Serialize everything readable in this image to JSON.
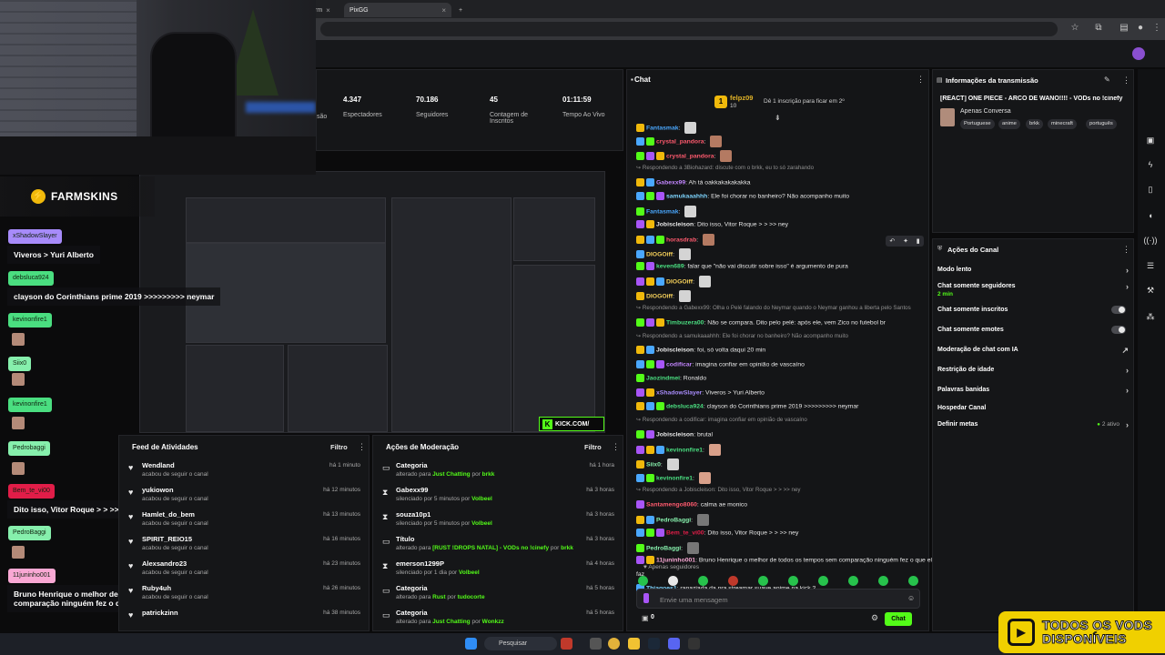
{
  "browser": {
    "tabs": [
      {
        "label": "rm"
      },
      {
        "label": "PixGG"
      }
    ]
  },
  "overlay": {
    "farmskins": "FARMSKINS",
    "chat": [
      {
        "name": "xShadowSlayer",
        "color": "#a78bfa",
        "msg": "Viveros > Yuri Alberto"
      },
      {
        "name": "debsluca924",
        "color": "#4ade80",
        "msg": "clayson do Corinthians prime 2019 >>>>>>>>> neymar"
      },
      {
        "name": "kevinonfire1",
        "color": "#4ade80",
        "msg": ""
      },
      {
        "name": "Siix0",
        "color": "#86efac",
        "msg": ""
      },
      {
        "name": "kevinonfire1",
        "color": "#4ade80",
        "msg": ""
      },
      {
        "name": "Pedrobaggi",
        "color": "#86efac",
        "msg": ""
      },
      {
        "name": "Bem_te_vi00",
        "color": "#e11d48",
        "msg": "Dito isso, Vitor Roque > > >> ney"
      },
      {
        "name": "PedroBaggi",
        "color": "#86efac",
        "msg": ""
      },
      {
        "name": "11juninho001",
        "color": "#f9a8d4",
        "msg": "Bruno Henrique o melhor de todos os tempos sem comparação ninguém fez o que ele faz"
      }
    ]
  },
  "stats": [
    {
      "value": "4.347",
      "label": "Espectadores"
    },
    {
      "value": "70.186",
      "label": "Seguidores"
    },
    {
      "value": "45",
      "label": "Contagem de Inscritos"
    },
    {
      "value": "01:11:59",
      "label": "Tempo Ao Vivo"
    }
  ],
  "stats_partial_label": "são",
  "kick_badge": "KICK.COM/",
  "feed": {
    "title": "Feed de Atividades",
    "filter": "Filtro",
    "items": [
      {
        "name": "Wendland",
        "desc": "acabou de seguir o canal",
        "time": "há 1 minuto"
      },
      {
        "name": "yukiowon",
        "desc": "acabou de seguir o canal",
        "time": "há 12 minutos"
      },
      {
        "name": "Hamlet_do_bem",
        "desc": "acabou de seguir o canal",
        "time": "há 13 minutos"
      },
      {
        "name": "SPIRIT_REIO15",
        "desc": "acabou de seguir o canal",
        "time": "há 16 minutos"
      },
      {
        "name": "Alexsandro23",
        "desc": "acabou de seguir o canal",
        "time": "há 23 minutos"
      },
      {
        "name": "Ruby4uh",
        "desc": "acabou de seguir o canal",
        "time": "há 26 minutos"
      },
      {
        "name": "patrickzinn",
        "desc": "",
        "time": "há 38 minutos"
      }
    ]
  },
  "moderation": {
    "title": "Ações de Moderação",
    "filter": "Filtro",
    "items": [
      {
        "icon": "tv-icon",
        "glyph": "▭",
        "name": "Categoria",
        "pre": "alterado para ",
        "hl": "Just Chatting",
        "mid": " por ",
        "by": "brkk",
        "time": "há 1 hora"
      },
      {
        "icon": "hourglass-icon",
        "glyph": "⧗",
        "name": "Gabexx99",
        "pre": "silenciado por 5 minutos por ",
        "hl": "",
        "mid": "",
        "by": "Volbeel",
        "time": "há 3 horas"
      },
      {
        "icon": "hourglass-icon",
        "glyph": "⧗",
        "name": "souza10p1",
        "pre": "silenciado por 5 minutos por ",
        "hl": "",
        "mid": "",
        "by": "Volbeel",
        "time": "há 3 horas"
      },
      {
        "icon": "tv-icon",
        "glyph": "▭",
        "name": "Título",
        "pre": "alterado para ",
        "hl": "[RUST !DROPS NATAL] - VODs no !cinefy",
        "mid": " por ",
        "by": "brkk",
        "time": "há 3 horas"
      },
      {
        "icon": "hourglass-icon",
        "glyph": "⧗",
        "name": "emerson1299P",
        "pre": "silenciado por 1 dia por ",
        "hl": "",
        "mid": "",
        "by": "Volbeel",
        "time": "há 4 horas"
      },
      {
        "icon": "tv-icon",
        "glyph": "▭",
        "name": "Categoria",
        "pre": "alterado para ",
        "hl": "Rust",
        "mid": " por ",
        "by": "tudocorte",
        "time": "há 5 horas"
      },
      {
        "icon": "tv-icon",
        "glyph": "▭",
        "name": "Categoria",
        "pre": "alterado para ",
        "hl": "Just Chatting",
        "mid": " por ",
        "by": "Wonkzz",
        "time": "há 5 horas"
      }
    ]
  },
  "chat": {
    "title": "Chat",
    "pinned": {
      "user": "felpz09",
      "count": "10",
      "text": "Dê 1 inscrição para ficar em 2º"
    },
    "lines": [
      {
        "type": "msg",
        "user": "Fantasmak",
        "color": "#4aa8ff",
        "text": "",
        "emote": "#d4d4d4"
      },
      {
        "type": "msg",
        "user": "crystal_pandora",
        "color": "#ff5a6e",
        "text": "",
        "emote": "#b47a62"
      },
      {
        "type": "msg",
        "user": "crystal_pandora",
        "color": "#ff5a6e",
        "text": "",
        "emote": "#b47a62"
      },
      {
        "type": "reply",
        "text": "Respondendo a 3Biohazard: discute com o brkk, eu to só zarahando"
      },
      {
        "type": "msg",
        "user": "Gabexx99",
        "color": "#c084fc",
        "text": "Ah tá oakkakakakakka"
      },
      {
        "type": "msg",
        "user": "samukaaahhh",
        "color": "#7dd3fc",
        "text": "Ele foi chorar no banheiro? Não acompanho muito"
      },
      {
        "type": "msg",
        "user": "Fantasmak",
        "color": "#4aa8ff",
        "text": "",
        "emote": "#d4d4d4"
      },
      {
        "type": "msg",
        "user": "Jobiscleison",
        "color": "#e8e8e8",
        "text": "Dito isso, Vitor Roque > > >> ney"
      },
      {
        "type": "msg",
        "user": "horasdrab",
        "color": "#ff5a6e",
        "text": "",
        "emote": "#b47a62"
      },
      {
        "type": "msg",
        "user": "DIOGOiff",
        "color": "#f5d05a",
        "text": "",
        "emote": "#d4d4d4"
      },
      {
        "type": "msg",
        "user": "keven689",
        "color": "#4ade80",
        "text": "falar que \"não vai discutir sobre isso\" é argumento de pura"
      },
      {
        "type": "msg",
        "user": "DIOGOiff",
        "color": "#f5d05a",
        "text": "",
        "emote": "#d4d4d4"
      },
      {
        "type": "msg",
        "user": "DIOGOiff",
        "color": "#f5d05a",
        "text": "",
        "emote": "#d4d4d4"
      },
      {
        "type": "reply",
        "text": "Respondendo a Gabexx99: Olha o Pelé falando do Neymar quando o Neymar ganhou a liberta pelo Santos"
      },
      {
        "type": "msg",
        "user": "Timbuzera00",
        "color": "#4ade80",
        "text": "Não se compara. Dito pelo pelé: após ele, vem Zico no futebol br"
      },
      {
        "type": "reply",
        "text": "Respondendo a samukaaahhh: Ele foi chorar no banheiro? Não acompanho muito"
      },
      {
        "type": "msg",
        "user": "Jobiscleison",
        "color": "#e8e8e8",
        "text": "foi, só volta daqui 20 min"
      },
      {
        "type": "msg",
        "user": "codificar",
        "color": "#c084fc",
        "text": "imagina confiar em opinião de vascaíno"
      },
      {
        "type": "msg",
        "user": "Jaozindmei",
        "color": "#4ade80",
        "text": "Ronaldo"
      },
      {
        "type": "msg",
        "user": "xShadowSlayer",
        "color": "#a78bfa",
        "text": "Viveros > Yuri Alberto"
      },
      {
        "type": "msg",
        "user": "debsluca924",
        "color": "#4ade80",
        "text": "clayson do Corinthians prime 2019 >>>>>>>>> neymar"
      },
      {
        "type": "reply",
        "text": "Respondendo a codificar: imagina confiar em opinião de vascaíno"
      },
      {
        "type": "msg",
        "user": "Jobiscleison",
        "color": "#e8e8e8",
        "text": "brutal"
      },
      {
        "type": "msg",
        "user": "kevinonfire1",
        "color": "#4ade80",
        "text": "",
        "emote": "#d9a08a"
      },
      {
        "type": "msg",
        "user": "Siix0",
        "color": "#86efac",
        "text": "",
        "emote": "#d4d4d4"
      },
      {
        "type": "msg",
        "user": "kevinonfire1",
        "color": "#4ade80",
        "text": "",
        "emote": "#d9a08a"
      },
      {
        "type": "reply",
        "text": "Respondendo a Jobiscleison: Dito isso, Vitor Roque > > >> ney"
      },
      {
        "type": "msg",
        "user": "Santamengo8060",
        "color": "#ff5a6e",
        "text": "calma ae monico"
      },
      {
        "type": "msg",
        "user": "PedroBaggi",
        "color": "#86efac",
        "text": "",
        "emote": "#777"
      },
      {
        "type": "msg",
        "user": "Bem_te_vi00",
        "color": "#e11d48",
        "text": "Dito isso, Vitor Roque > > >> ney"
      },
      {
        "type": "msg",
        "user": "PedroBaggi",
        "color": "#86efac",
        "text": "",
        "emote": "#777"
      },
      {
        "type": "msg",
        "user": "11juninho001",
        "color": "#f9a8d4",
        "text": "Bruno Henrique o melhor de todos os tempos sem comparação ninguém fez o que ele"
      },
      {
        "type": "cont",
        "text": "faz"
      },
      {
        "type": "msg",
        "user": "Thiagoes1",
        "color": "#7dd3fc",
        "text": "rapaziada,da pra streamar suave anime na kick ?"
      }
    ],
    "apenas": "Apenas seguidores",
    "placeholder": "Envie uma mensagem",
    "send": "Chat",
    "viewer_count": "0"
  },
  "info": {
    "title": "Informações da transmissão",
    "stream_title": "[REACT] ONE PIECE - ARCO DE WANO!!!! - VODs no !cinefy",
    "category": "Apenas Conversa",
    "tags": [
      "Portuguese",
      "anime",
      "brkk",
      "minecraft",
      "português"
    ]
  },
  "actions": {
    "title": "Ações do Canal",
    "items": [
      {
        "label": "Modo lento",
        "kind": "chev",
        "sub": ""
      },
      {
        "label": "Chat somente seguidores",
        "kind": "chev",
        "sub": "2 min"
      },
      {
        "label": "Chat somente inscritos",
        "kind": "toggle",
        "sub": ""
      },
      {
        "label": "Chat somente emotes",
        "kind": "toggle",
        "sub": ""
      },
      {
        "label": "Moderação de chat com IA",
        "kind": "ext",
        "sub": ""
      },
      {
        "label": "Restrição de idade",
        "kind": "chev",
        "sub": ""
      },
      {
        "label": "Palavras banidas",
        "kind": "chev",
        "sub": ""
      },
      {
        "label": "Hospedar Canal",
        "kind": "none",
        "sub": ""
      },
      {
        "label": "Definir metas",
        "kind": "chev",
        "sub": "",
        "badge": "2 ativo"
      }
    ]
  },
  "taskbar": {
    "search": "Pesquisar"
  },
  "vod_banner": {
    "line1": "TODOS OS VODS",
    "line2": "DISPONÍVEIS"
  },
  "colors": {
    "kick_green": "#53fc18",
    "accent_yellow": "#f0d000"
  }
}
